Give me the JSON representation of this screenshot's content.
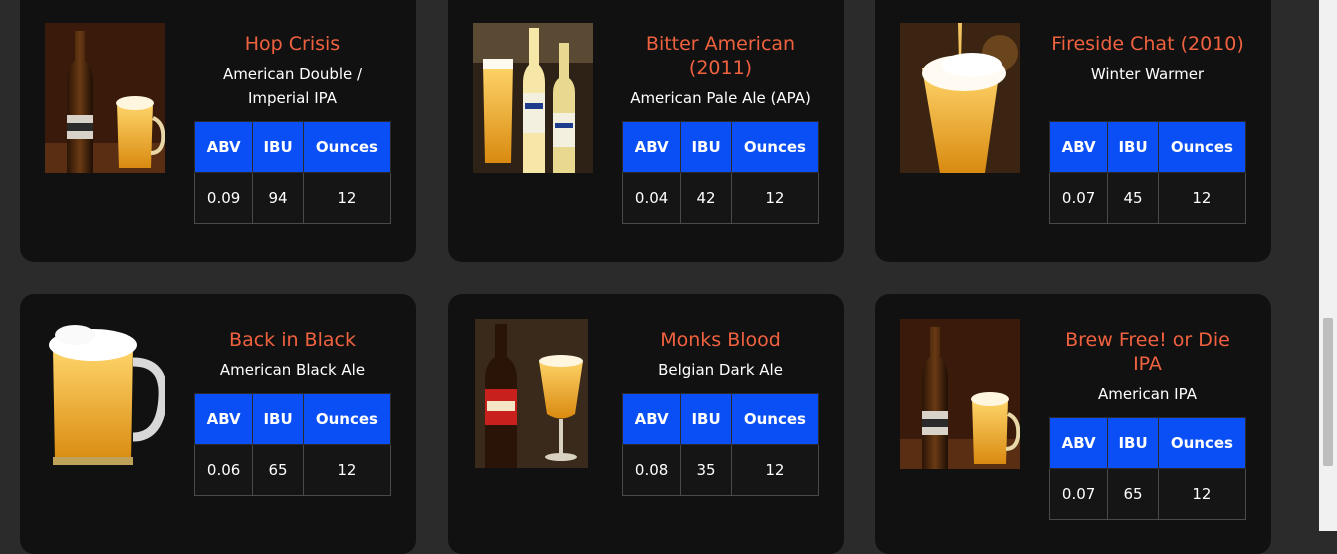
{
  "table_headers": {
    "abv": "ABV",
    "ibu": "IBU",
    "ounces": "Ounces"
  },
  "beers": [
    {
      "name": "Hop Crisis",
      "style": "American Double / Imperial IPA",
      "abv": "0.09",
      "ibu": "94",
      "ounces": "12",
      "image": "beer-bottle-and-mug-photo"
    },
    {
      "name": "Bitter American (2011)",
      "style": "American Pale Ale (APA)",
      "abv": "0.04",
      "ibu": "42",
      "ounces": "12",
      "image": "corona-bottles-photo"
    },
    {
      "name": "Fireside Chat (2010)",
      "style": "Winter Warmer",
      "abv": "0.07",
      "ibu": "45",
      "ounces": "12",
      "image": "beer-pour-glass-photo"
    },
    {
      "name": "Back in Black",
      "style": "American Black Ale",
      "abv": "0.06",
      "ibu": "65",
      "ounces": "12",
      "image": "beer-mug-photo"
    },
    {
      "name": "Monks Blood",
      "style": "Belgian Dark Ale",
      "abv": "0.08",
      "ibu": "35",
      "ounces": "12",
      "image": "red-label-bottle-and-glass-photo"
    },
    {
      "name": "Brew Free! or Die IPA",
      "style": "American IPA",
      "abv": "0.07",
      "ibu": "65",
      "ounces": "12",
      "image": "beer-bottle-and-mug-photo"
    }
  ],
  "colors": {
    "accent_name": "#f0623f",
    "table_header": "#0a4ff5",
    "card_bg": "#111111",
    "page_bg": "#2b2b2b"
  }
}
